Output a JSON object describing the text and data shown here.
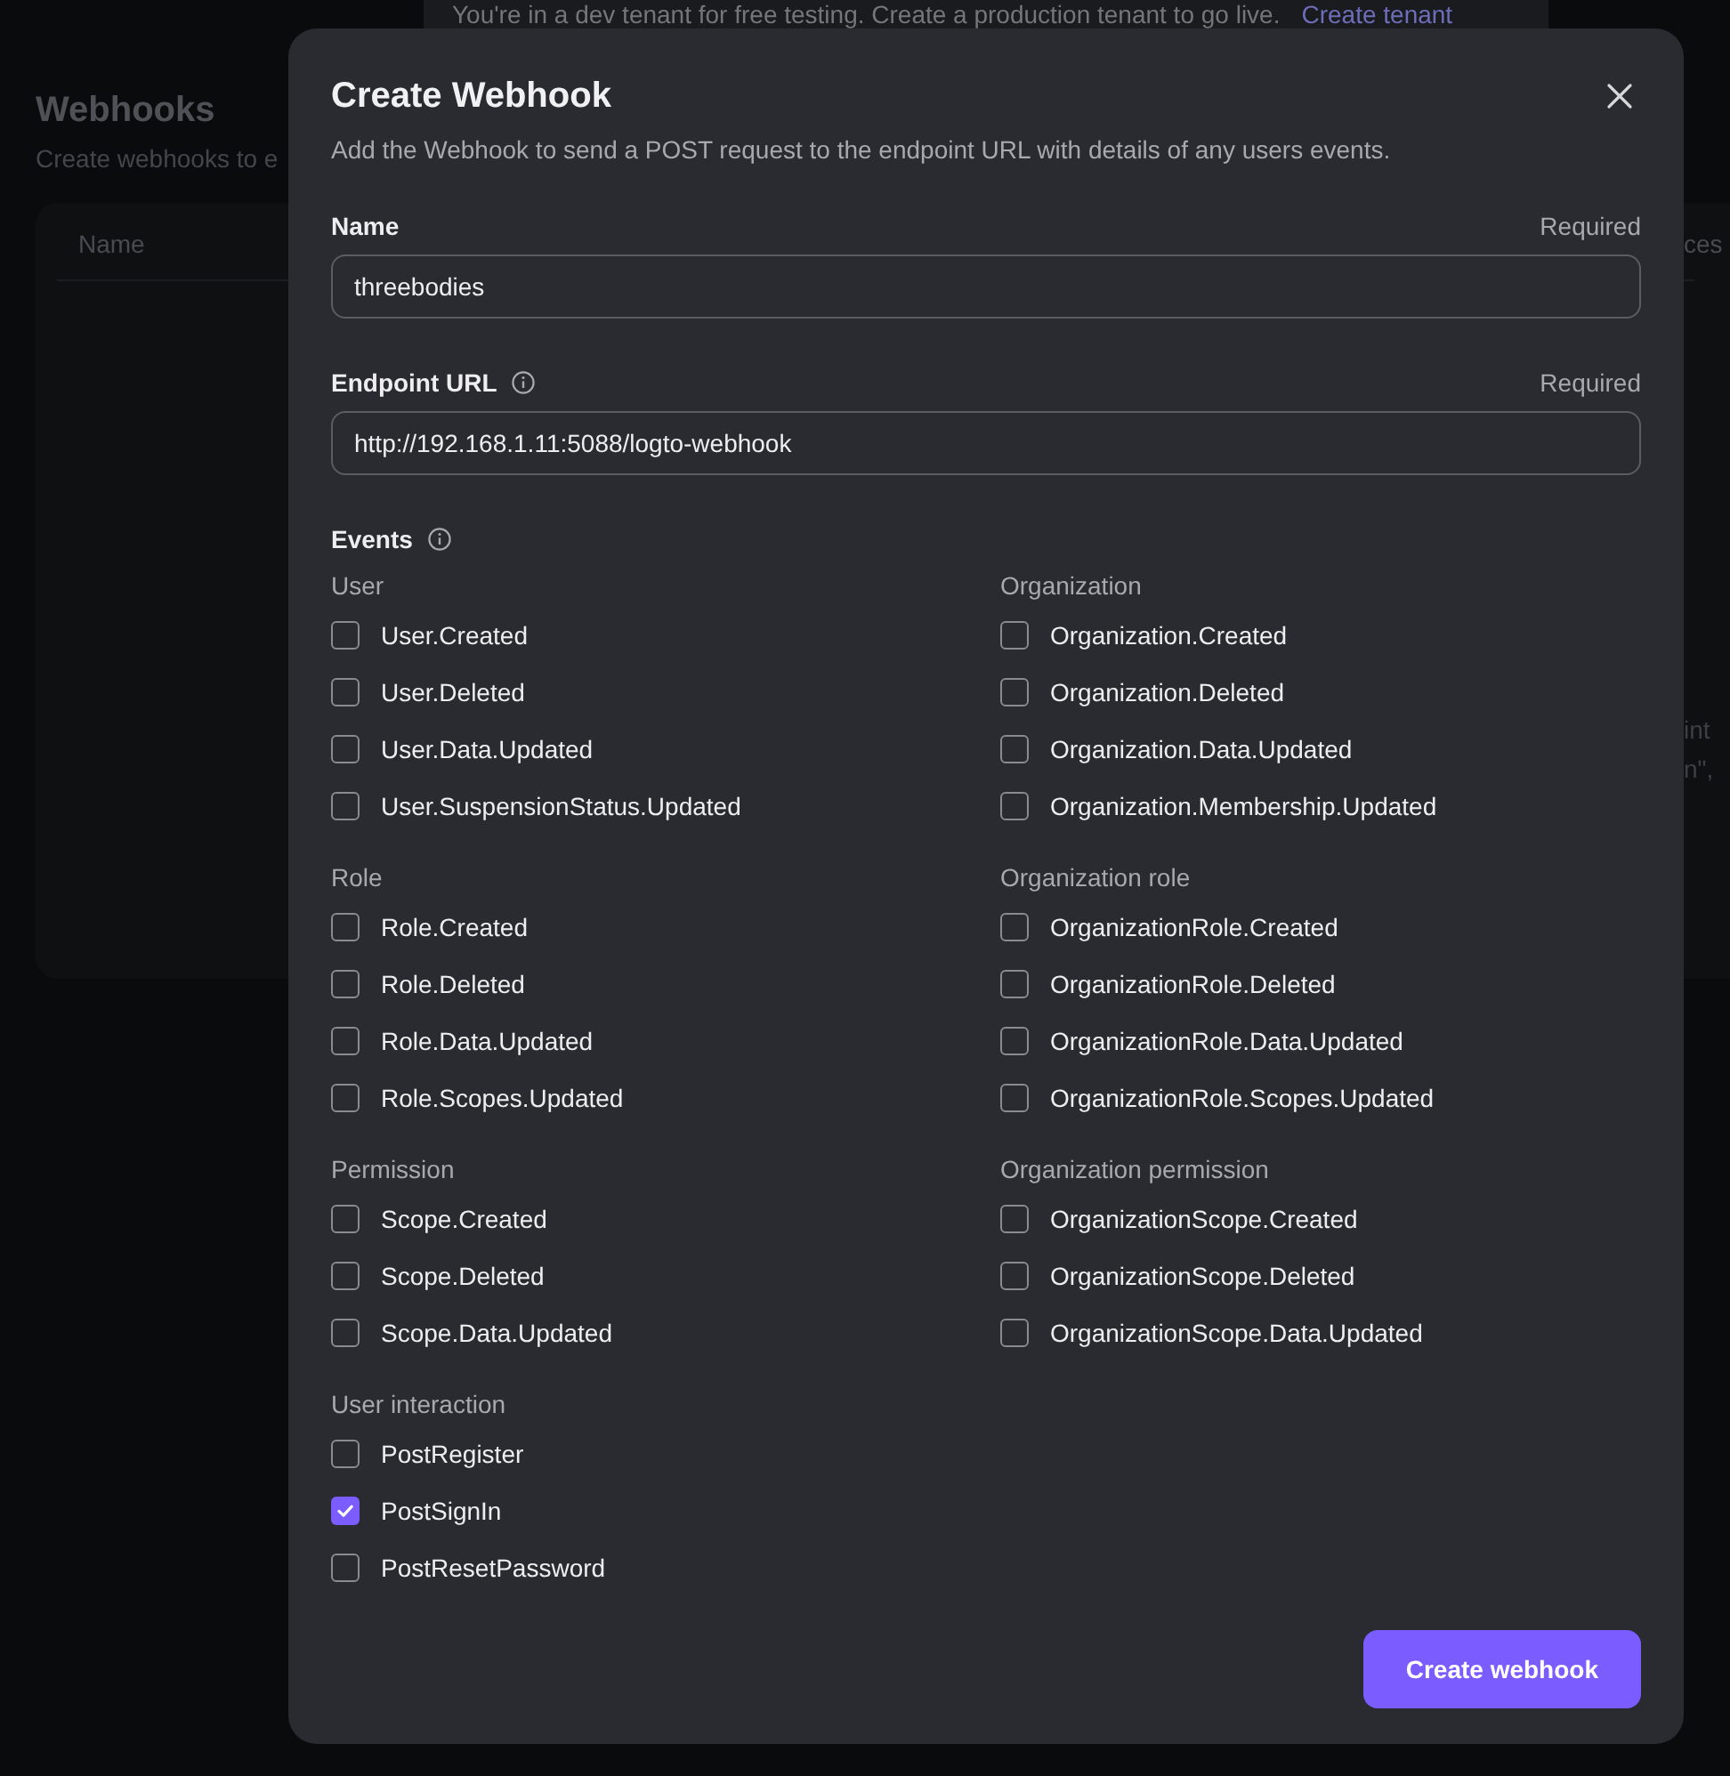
{
  "banner": {
    "text": "You're in a dev tenant for free testing. Create a production tenant to go live.",
    "link": "Create tenant"
  },
  "page": {
    "title": "Webhooks",
    "subtitle": "Create webhooks to e",
    "table": {
      "columns": [
        "Name",
        "ces"
      ],
      "cell_lines": [
        "int",
        "n\","
      ]
    }
  },
  "dialog": {
    "title": "Create Webhook",
    "subtitle": "Add the Webhook to send a POST request to the endpoint URL with details of any users events.",
    "fields": [
      {
        "label": "Name",
        "info": false,
        "hint": "Required",
        "value": "threebodies"
      },
      {
        "label": "Endpoint URL",
        "info": true,
        "hint": "Required",
        "value": "http://192.168.1.11:5088/logto-webhook"
      }
    ],
    "events": {
      "label": "Events",
      "info": true,
      "columns": [
        [
          {
            "title": "User",
            "events": [
              {
                "label": "User.Created",
                "checked": false
              },
              {
                "label": "User.Deleted",
                "checked": false
              },
              {
                "label": "User.Data.Updated",
                "checked": false
              },
              {
                "label": "User.SuspensionStatus.Updated",
                "checked": false
              }
            ]
          },
          {
            "title": "Role",
            "events": [
              {
                "label": "Role.Created",
                "checked": false
              },
              {
                "label": "Role.Deleted",
                "checked": false
              },
              {
                "label": "Role.Data.Updated",
                "checked": false
              },
              {
                "label": "Role.Scopes.Updated",
                "checked": false
              }
            ]
          },
          {
            "title": "Permission",
            "events": [
              {
                "label": "Scope.Created",
                "checked": false
              },
              {
                "label": "Scope.Deleted",
                "checked": false
              },
              {
                "label": "Scope.Data.Updated",
                "checked": false
              }
            ]
          },
          {
            "title": "User interaction",
            "events": [
              {
                "label": "PostRegister",
                "checked": false
              },
              {
                "label": "PostSignIn",
                "checked": true
              },
              {
                "label": "PostResetPassword",
                "checked": false
              }
            ]
          }
        ],
        [
          {
            "title": "Organization",
            "events": [
              {
                "label": "Organization.Created",
                "checked": false
              },
              {
                "label": "Organization.Deleted",
                "checked": false
              },
              {
                "label": "Organization.Data.Updated",
                "checked": false
              },
              {
                "label": "Organization.Membership.Updated",
                "checked": false
              }
            ]
          },
          {
            "title": "Organization role",
            "events": [
              {
                "label": "OrganizationRole.Created",
                "checked": false
              },
              {
                "label": "OrganizationRole.Deleted",
                "checked": false
              },
              {
                "label": "OrganizationRole.Data.Updated",
                "checked": false
              },
              {
                "label": "OrganizationRole.Scopes.Updated",
                "checked": false
              }
            ]
          },
          {
            "title": "Organization permission",
            "events": [
              {
                "label": "OrganizationScope.Created",
                "checked": false
              },
              {
                "label": "OrganizationScope.Deleted",
                "checked": false
              },
              {
                "label": "OrganizationScope.Data.Updated",
                "checked": false
              }
            ]
          }
        ]
      ]
    },
    "submit": "Create webhook"
  }
}
